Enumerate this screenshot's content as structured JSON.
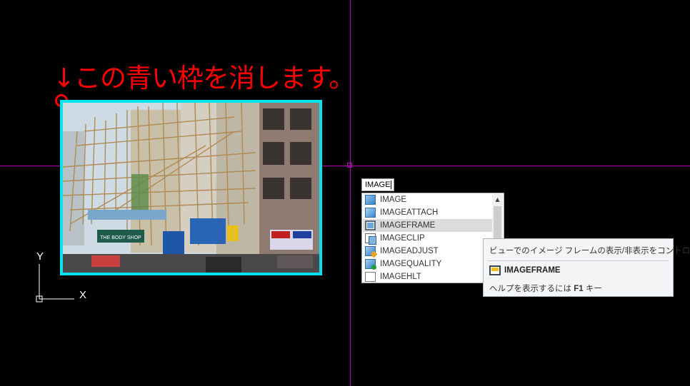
{
  "annotation": {
    "text": "↓この青い枠を消します。",
    "color": "#ff0000"
  },
  "image": {
    "frame_color": "#00e5ee",
    "sign_text": "THE BODY SHOP"
  },
  "ucs": {
    "x_label": "X",
    "y_label": "Y"
  },
  "command_line": {
    "value": "IMAGE"
  },
  "autocomplete": {
    "items": [
      {
        "label": "IMAGE",
        "icon": "image-icon"
      },
      {
        "label": "IMAGEATTACH",
        "icon": "image-attach-icon"
      },
      {
        "label": "IMAGEFRAME",
        "icon": "image-frame-icon",
        "selected": true
      },
      {
        "label": "IMAGECLIP",
        "icon": "image-clip-icon"
      },
      {
        "label": "IMAGEADJUST",
        "icon": "image-adjust-icon"
      },
      {
        "label": "IMAGEQUALITY",
        "icon": "image-quality-icon"
      },
      {
        "label": "IMAGEHLT",
        "icon": "image-hlt-icon"
      }
    ],
    "scroll_up_glyph": "▲"
  },
  "tooltip": {
    "description": "ビューでのイメージ フレームの表示/非表示をコントロール",
    "command": "IMAGEFRAME",
    "help_prefix": "ヘルプを表示するには ",
    "help_key": "F1",
    "help_suffix": " キー"
  },
  "colors": {
    "background": "#000000",
    "crosshair": "#b000b0",
    "selected_row": "#dcdcdc"
  }
}
